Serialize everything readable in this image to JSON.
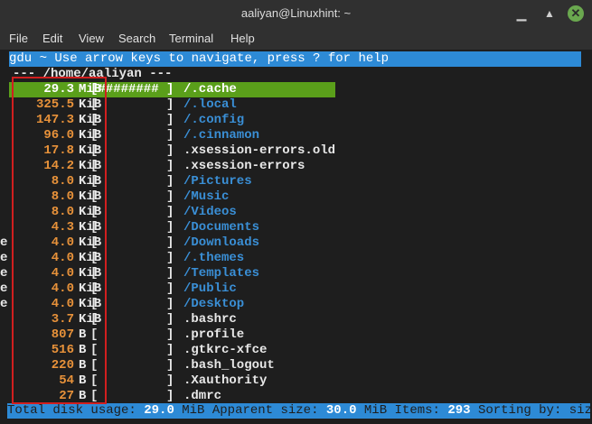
{
  "window": {
    "title": "aaliyan@Linuxhint: ~"
  },
  "menu": [
    "File",
    "Edit",
    "View",
    "Search",
    "Terminal",
    "Help"
  ],
  "help_bar": "gdu ~ Use arrow keys to navigate, press ? for help",
  "path_line": "--- /home/aaliyan ---",
  "rows": [
    {
      "edge": "",
      "size": "29.3",
      "unit": "MiB",
      "bar": "[######## ]",
      "name": "/.cache",
      "dir": true,
      "selected": true
    },
    {
      "edge": "",
      "size": "325.5",
      "unit": "KiB",
      "bar": "[         ]",
      "name": "/.local",
      "dir": true
    },
    {
      "edge": "",
      "size": "147.3",
      "unit": "KiB",
      "bar": "[         ]",
      "name": "/.config",
      "dir": true
    },
    {
      "edge": "",
      "size": "96.0",
      "unit": "KiB",
      "bar": "[         ]",
      "name": "/.cinnamon",
      "dir": true
    },
    {
      "edge": "",
      "size": "17.8",
      "unit": "KiB",
      "bar": "[         ]",
      "name": ".xsession-errors.old",
      "dir": false
    },
    {
      "edge": "",
      "size": "14.2",
      "unit": "KiB",
      "bar": "[         ]",
      "name": ".xsession-errors",
      "dir": false
    },
    {
      "edge": "",
      "size": "8.0",
      "unit": "KiB",
      "bar": "[         ]",
      "name": "/Pictures",
      "dir": true
    },
    {
      "edge": "",
      "size": "8.0",
      "unit": "KiB",
      "bar": "[         ]",
      "name": "/Music",
      "dir": true
    },
    {
      "edge": "",
      "size": "8.0",
      "unit": "KiB",
      "bar": "[         ]",
      "name": "/Videos",
      "dir": true
    },
    {
      "edge": "",
      "size": "4.3",
      "unit": "KiB",
      "bar": "[         ]",
      "name": "/Documents",
      "dir": true
    },
    {
      "edge": "e",
      "size": "4.0",
      "unit": "KiB",
      "bar": "[         ]",
      "name": "/Downloads",
      "dir": true
    },
    {
      "edge": "e",
      "size": "4.0",
      "unit": "KiB",
      "bar": "[         ]",
      "name": "/.themes",
      "dir": true
    },
    {
      "edge": "e",
      "size": "4.0",
      "unit": "KiB",
      "bar": "[         ]",
      "name": "/Templates",
      "dir": true
    },
    {
      "edge": "e",
      "size": "4.0",
      "unit": "KiB",
      "bar": "[         ]",
      "name": "/Public",
      "dir": true
    },
    {
      "edge": "e",
      "size": "4.0",
      "unit": "KiB",
      "bar": "[         ]",
      "name": "/Desktop",
      "dir": true
    },
    {
      "edge": "",
      "size": "3.7",
      "unit": "KiB",
      "bar": "[         ]",
      "name": ".bashrc",
      "dir": false
    },
    {
      "edge": "",
      "size": "807",
      "unit": "B",
      "bar": "[         ]",
      "name": ".profile",
      "dir": false
    },
    {
      "edge": "",
      "size": "516",
      "unit": "B",
      "bar": "[         ]",
      "name": ".gtkrc-xfce",
      "dir": false
    },
    {
      "edge": "",
      "size": "220",
      "unit": "B",
      "bar": "[         ]",
      "name": ".bash_logout",
      "dir": false
    },
    {
      "edge": "",
      "size": "54",
      "unit": "B",
      "bar": "[         ]",
      "name": ".Xauthority",
      "dir": false
    },
    {
      "edge": "",
      "size": "27",
      "unit": "B",
      "bar": "[         ]",
      "name": ".dmrc",
      "dir": false
    }
  ],
  "footer": {
    "total_label": "Total disk usage: ",
    "total_value": "29.0",
    "total_unit": " MiB ",
    "apparent_label": "Apparent size: ",
    "apparent_value": "30.0",
    "apparent_unit": " MiB ",
    "items_label": "Items: ",
    "items_value": "293",
    "sorting_label": " Sorting by: size"
  },
  "colors": {
    "help_bar": "#2d8ad6",
    "selected_row": "#5a9f1a",
    "size_text": "#e8923a",
    "dir_text": "#3a8fd6",
    "annotation_box": "#d11f1f"
  }
}
